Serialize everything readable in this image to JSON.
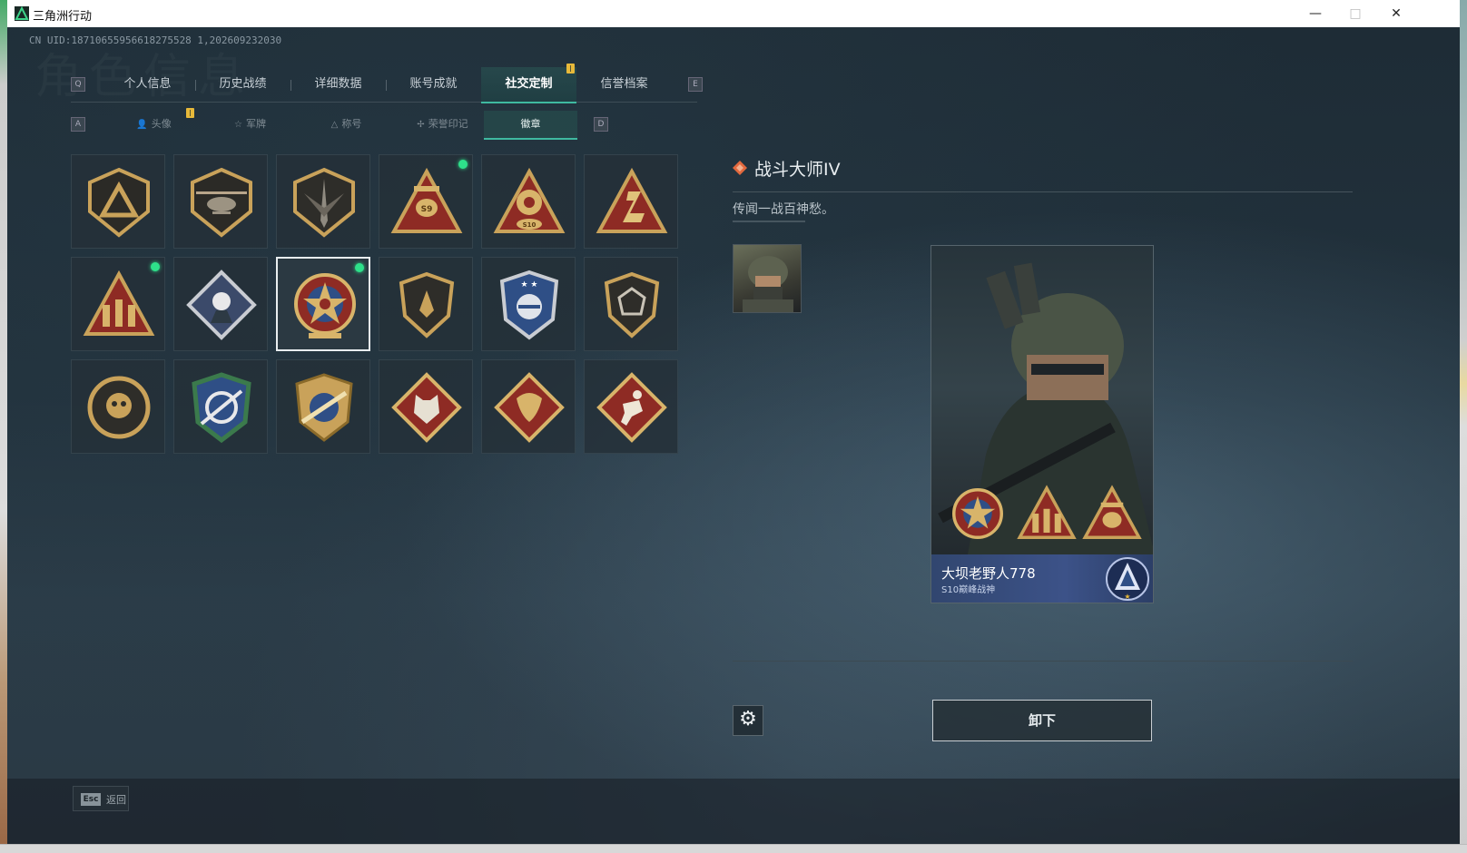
{
  "window": {
    "title": "三角洲行动",
    "controls": [
      "—",
      "□",
      "✕"
    ]
  },
  "header": {
    "uid": "CN UID:18710655956618275528 1,202609232030",
    "watermark": "角色信息"
  },
  "tabs": {
    "left_key": "Q",
    "right_key": "E",
    "items": [
      {
        "label": "个人信息",
        "active": false
      },
      {
        "label": "历史战绩",
        "active": false
      },
      {
        "label": "详细数据",
        "active": false
      },
      {
        "label": "账号成就",
        "active": false
      },
      {
        "label": "社交定制",
        "active": true
      },
      {
        "label": "信誉档案",
        "active": false
      }
    ]
  },
  "subtabs": {
    "left_key": "A",
    "right_key": "D",
    "items": [
      {
        "label": "头像",
        "icon": "person-icon",
        "active": false
      },
      {
        "label": "军牌",
        "icon": "dogtag-icon",
        "active": false
      },
      {
        "label": "称号",
        "icon": "title-icon",
        "active": false
      },
      {
        "label": "荣誉印记",
        "icon": "honor-icon",
        "active": false
      },
      {
        "label": "徽章",
        "icon": "",
        "active": true
      }
    ]
  },
  "badges": [
    {
      "name": "triangle-shield-badge",
      "new": false,
      "selected": false
    },
    {
      "name": "helicopter-badge",
      "new": false,
      "selected": false
    },
    {
      "name": "dagger-shield-badge",
      "new": false,
      "selected": false
    },
    {
      "name": "s9-winged-badge",
      "new": true,
      "selected": false
    },
    {
      "name": "s10-crest-badge",
      "new": false,
      "selected": false
    },
    {
      "name": "red-triangle-badge",
      "new": false,
      "selected": false
    },
    {
      "name": "squad-triangle-badge",
      "new": true,
      "selected": false
    },
    {
      "name": "rose-diamond-badge",
      "new": false,
      "selected": false
    },
    {
      "name": "star-medal-badge",
      "new": true,
      "selected": true
    },
    {
      "name": "plant-shield-badge",
      "new": false,
      "selected": false
    },
    {
      "name": "blue-crest-badge",
      "new": false,
      "selected": false
    },
    {
      "name": "gem-shield-badge",
      "new": false,
      "selected": false
    },
    {
      "name": "skull-round-badge",
      "new": false,
      "selected": false
    },
    {
      "name": "sniper-blue-badge",
      "new": false,
      "selected": false
    },
    {
      "name": "rifle-gold-badge",
      "new": false,
      "selected": false
    },
    {
      "name": "wolf-diamond-badge",
      "new": false,
      "selected": false
    },
    {
      "name": "dragon-diamond-badge",
      "new": false,
      "selected": false
    },
    {
      "name": "runner-diamond-badge",
      "new": false,
      "selected": false
    }
  ],
  "detail": {
    "title": "战斗大师IV",
    "description": "传闻一战百神愁。"
  },
  "card": {
    "player_name": "大坝老野人778",
    "player_title": "S10巅峰战神"
  },
  "actions": {
    "unequip": "卸下",
    "back_key": "Esc",
    "back_label": "返回"
  },
  "colors": {
    "accent": "#3fb9a0",
    "new_dot": "#2ee08a",
    "badge_gold": "#c9a25a",
    "badge_red": "#8e2b24",
    "badge_blue": "#2f4f86"
  }
}
